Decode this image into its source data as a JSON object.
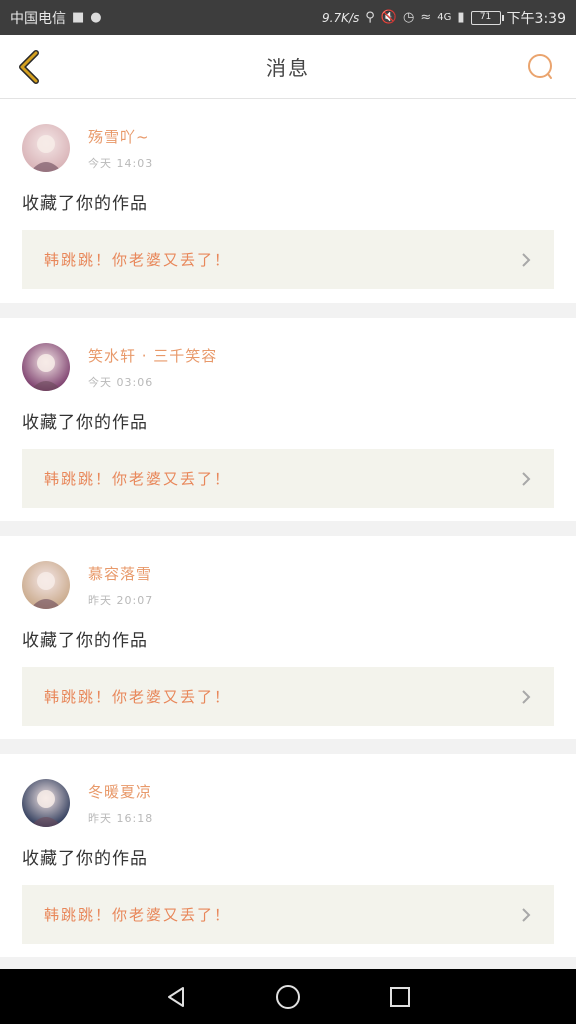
{
  "status_bar": {
    "carrier": "中国电信",
    "speed": "9.7K/s",
    "network": "4G",
    "battery": "71",
    "time": "下午3:39"
  },
  "header": {
    "title": "消息",
    "back_icon": "chevron-left-icon",
    "search_icon": "search-icon"
  },
  "messages": [
    {
      "name": "殇雪吖~",
      "time": "今天 14:03",
      "action": "收藏了你的作品",
      "work": "韩跳跳！你老婆又丢了！",
      "avatar_color": "#d8b2b6"
    },
    {
      "name": "笑水轩 · 三千笑容",
      "time": "今天 03:06",
      "action": "收藏了你的作品",
      "work": "韩跳跳！你老婆又丢了！",
      "avatar_color": "#7a3c6b"
    },
    {
      "name": "慕容落雪",
      "time": "昨天 20:07",
      "action": "收藏了你的作品",
      "work": "韩跳跳！你老婆又丢了！",
      "avatar_color": "#c9a98a"
    },
    {
      "name": "冬暖夏凉",
      "time": "昨天 16:18",
      "action": "收藏了你的作品",
      "work": "韩跳跳！你老婆又丢了！",
      "avatar_color": "#2d3a5a"
    }
  ],
  "colors": {
    "accent": "#e8996a",
    "back_icon": "#d4a020"
  },
  "nav_bar": {
    "back": "triangle-back-icon",
    "home": "circle-home-icon",
    "recents": "square-recents-icon"
  }
}
